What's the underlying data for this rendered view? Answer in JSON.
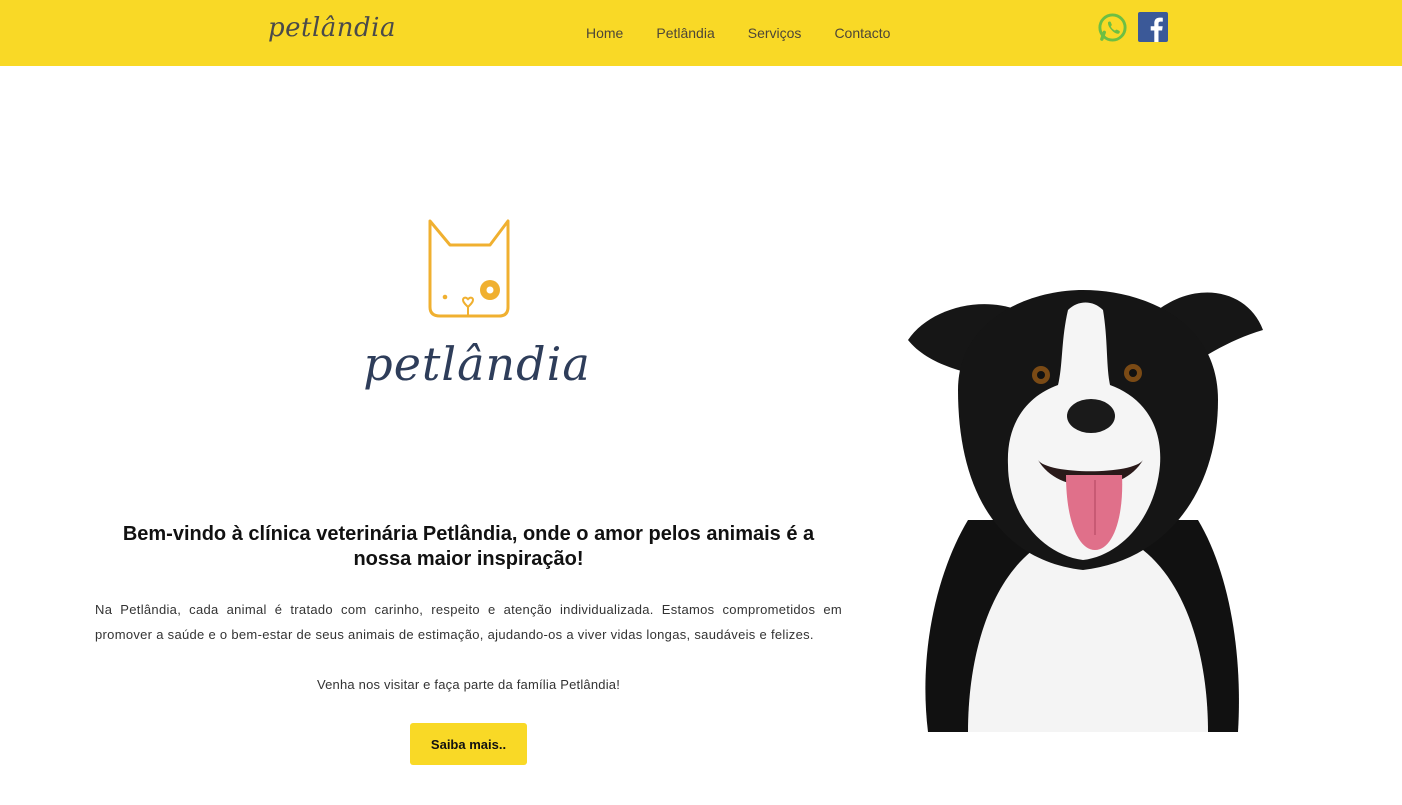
{
  "header": {
    "brand": "petlândia",
    "nav": [
      {
        "label": "Home"
      },
      {
        "label": "Petlândia"
      },
      {
        "label": "Serviços"
      },
      {
        "label": "Contacto"
      }
    ],
    "social": [
      {
        "icon": "whatsapp-icon",
        "color": "#6dbf43"
      },
      {
        "icon": "facebook-icon",
        "color": "#3b5998"
      }
    ],
    "background": "#f9d926"
  },
  "hero": {
    "logo_word": "petlândia",
    "logo_icon": "cat-face-icon",
    "logo_icon_color": "#f0b030",
    "logo_text_color": "#2e3d5a"
  },
  "content": {
    "headline": "Bem-vindo à clínica veterinária Petlândia, onde o amor pelos animais é a nossa maior inspiração!",
    "paragraph": "Na Petlândia, cada animal é tratado com carinho, respeito e atenção individualizada. Estamos comprometidos em promover a saúde e o bem-estar de seus animais de estimação, ajudando-os a viver vidas longas, saudáveis e felizes.",
    "invite": "Venha nos visitar e faça parte da família Petlândia!",
    "cta_label": "Saiba mais.."
  },
  "image": {
    "subject": "dog-photo"
  }
}
